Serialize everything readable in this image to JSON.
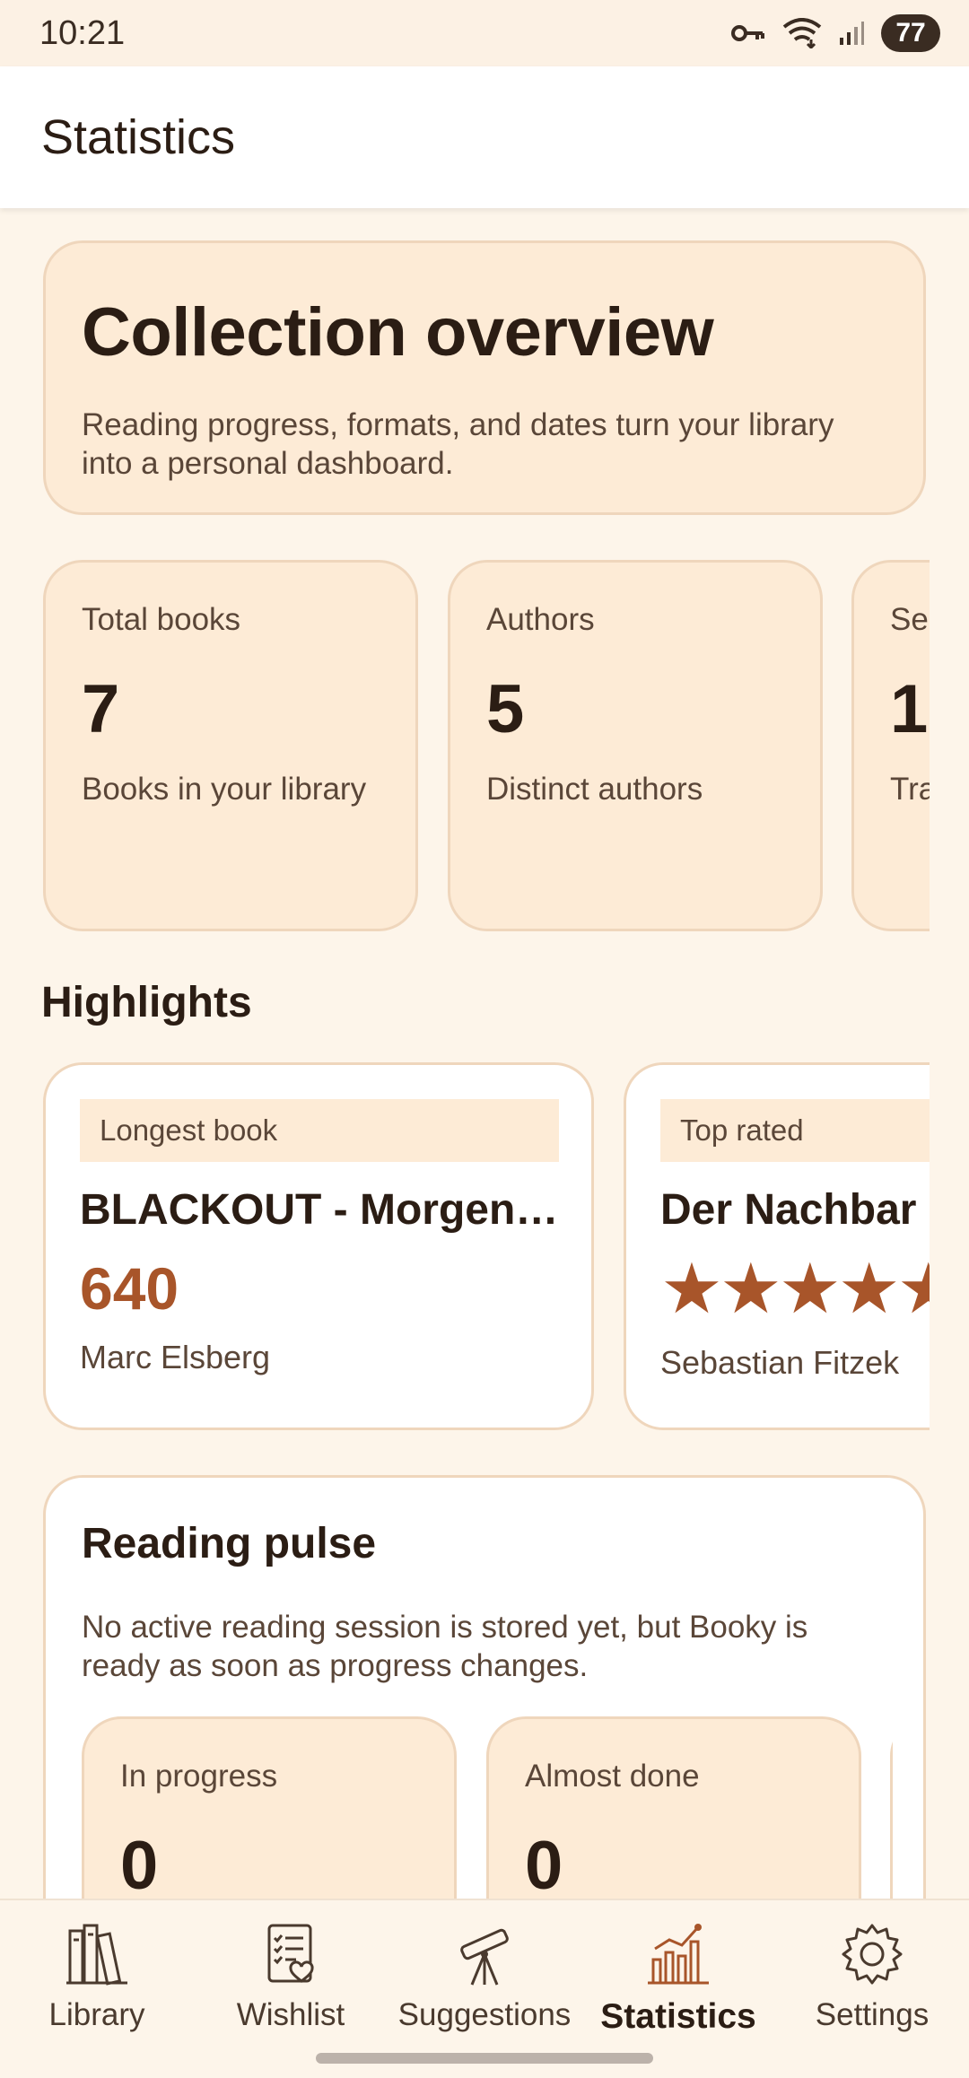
{
  "status": {
    "time": "10:21",
    "battery": "77"
  },
  "appbar": {
    "title": "Statistics"
  },
  "overview": {
    "title": "Collection overview",
    "description": "Reading progress, formats, and dates turn your library into a personal dashboard."
  },
  "stats": [
    {
      "label": "Total books",
      "value": "7",
      "desc": "Books in your library"
    },
    {
      "label": "Authors",
      "value": "5",
      "desc": "Distinct authors"
    },
    {
      "label": "Ser",
      "value": "1",
      "desc": "Tra"
    }
  ],
  "highlights": {
    "title": "Highlights",
    "cards": [
      {
        "chip": "Longest book",
        "title": "BLACKOUT - Morgen ist es zu spät",
        "value": "640",
        "author": "Marc Elsberg"
      },
      {
        "chip": "Top rated",
        "title": "Der Nachbar",
        "rating": 5,
        "stars": "★★★★★",
        "author": "Sebastian Fitzek"
      }
    ]
  },
  "pulse": {
    "title": "Reading pulse",
    "description": "No active reading session is stored yet, but Booky is ready as soon as progress changes.",
    "cards": [
      {
        "label": "In progress",
        "value": "0"
      },
      {
        "label": "Almost done",
        "value": "0"
      }
    ]
  },
  "nav": {
    "items": [
      {
        "label": "Library",
        "icon": "books-icon"
      },
      {
        "label": "Wishlist",
        "icon": "wishlist-icon"
      },
      {
        "label": "Suggestions",
        "icon": "telescope-icon"
      },
      {
        "label": "Statistics",
        "icon": "chart-icon",
        "active": true
      },
      {
        "label": "Settings",
        "icon": "gear-icon"
      }
    ]
  },
  "colors": {
    "accent": "#a8552a",
    "card": "#fdebd6",
    "background": "#fdf5ea"
  }
}
